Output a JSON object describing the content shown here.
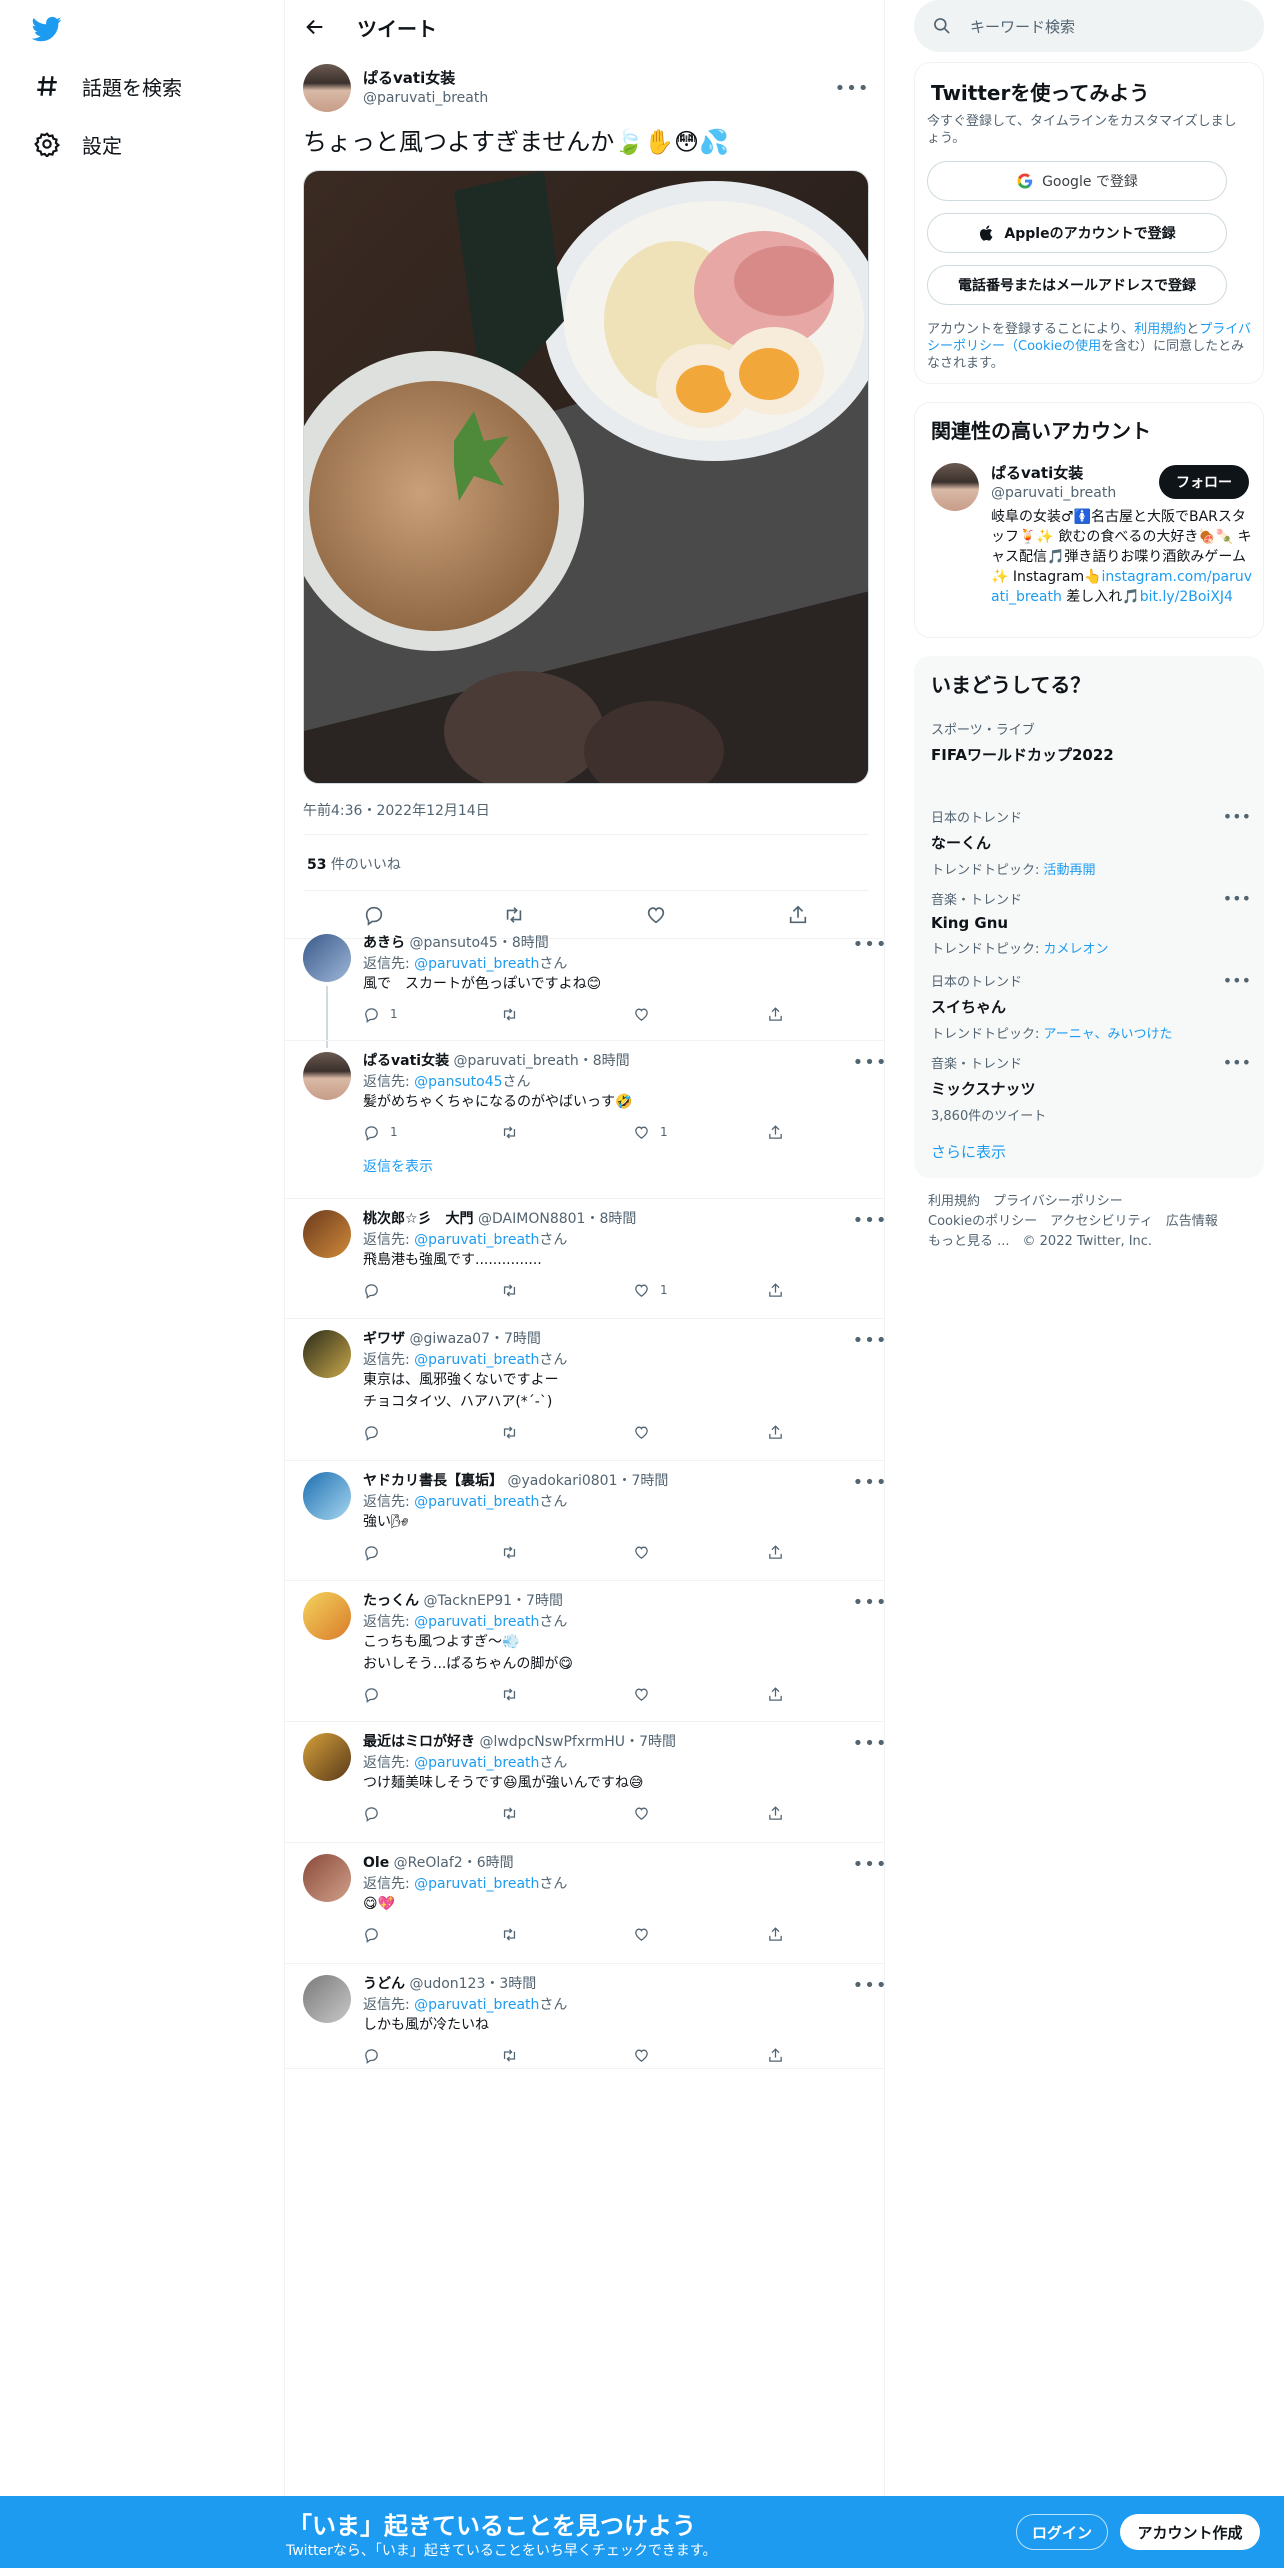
{
  "nav": {
    "items": [
      {
        "label": "話題を検索",
        "icon": "hashtag-icon"
      },
      {
        "label": "設定",
        "icon": "gear-icon"
      }
    ]
  },
  "header": {
    "title": "ツイート"
  },
  "tweet": {
    "display_name": "ぱるvati女装",
    "username": "@paruvati_breath",
    "text": "ちょっと風つよすぎませんか🍃✋😳💦",
    "timestamp": "午前4:36・2022年12月14日",
    "likes_count": "53",
    "likes_label": " 件のいいね"
  },
  "replies": [
    {
      "name": "あきら",
      "handle": "@pansuto45",
      "time": "8時間",
      "reply_to": "@paruvati_breath",
      "text": [
        "風で　スカートが色っぽいですよね😊"
      ],
      "reply_count": "1",
      "retweet_count": "",
      "like_count": ""
    },
    {
      "name": "ぱるvati女装",
      "handle": "@paruvati_breath",
      "time": "8時間",
      "reply_to": "@pansuto45",
      "text": [
        "髪がめちゃくちゃになるのがやばいっす🤣"
      ],
      "reply_count": "1",
      "retweet_count": "",
      "like_count": "1"
    },
    {
      "name": "桃次郎☆彡　大門",
      "handle": "@DAIMON8801",
      "time": "8時間",
      "reply_to": "@paruvati_breath",
      "text": [
        "飛島港も強風です..............."
      ],
      "reply_count": "",
      "retweet_count": "",
      "like_count": "1"
    },
    {
      "name": "ギワザ",
      "handle": "@giwaza07",
      "time": "7時間",
      "reply_to": "@paruvati_breath",
      "text": [
        "東京は、風邪強くないですよー",
        "チョコタイツ、ハアハア(*´-`)"
      ],
      "reply_count": "",
      "retweet_count": "",
      "like_count": ""
    },
    {
      "name": "ヤドカリ書長【裏垢】",
      "handle": "@yadokari0801",
      "time": "7時間",
      "reply_to": "@paruvati_breath",
      "text": [
        "強い🌬"
      ],
      "reply_count": "",
      "retweet_count": "",
      "like_count": ""
    },
    {
      "name": "たっくん",
      "handle": "@TacknEP91",
      "time": "7時間",
      "reply_to": "@paruvati_breath",
      "text": [
        "こっちも風つよすぎ～💨",
        "おいしそう...ぱるちゃんの脚が😋"
      ],
      "reply_count": "",
      "retweet_count": "",
      "like_count": ""
    },
    {
      "name": "最近はミロが好き",
      "handle": "@lwdpcNswPfxrmHU",
      "time": "7時間",
      "reply_to": "@paruvati_breath",
      "text": [
        "つけ麺美味しそうです😆風が強いんですね😅"
      ],
      "reply_count": "",
      "retweet_count": "",
      "like_count": ""
    },
    {
      "name": "Ole",
      "handle": "@ReOlaf2",
      "time": "6時間",
      "reply_to": "@paruvati_breath",
      "text": [
        "😋💖"
      ],
      "reply_count": "",
      "retweet_count": "",
      "like_count": ""
    },
    {
      "name": "うどん",
      "handle": "@udon123",
      "time": "3時間",
      "reply_to": "@paruvati_breath",
      "text": [
        "しかも風が冷たいね"
      ],
      "reply_count": "",
      "retweet_count": "",
      "like_count": ""
    }
  ],
  "common": {
    "reply_prefix": "返信先: ",
    "reply_suffix": "さん",
    "show_replies": "返信を表示",
    "sep": "・"
  },
  "search": {
    "placeholder": "キーワード検索"
  },
  "signup_card": {
    "title": "Twitterを使ってみよう",
    "subtitle": "今すぐ登録して、タイムラインをカスタマイズしましょう。",
    "google_btn": "Google で登録",
    "apple_btn": "Appleのアカウントで登録",
    "phone_btn": "電話番号またはメールアドレスで登録",
    "terms_1": "アカウントを登録することにより、",
    "terms_link1": "利用規約",
    "terms_2": "と",
    "terms_link2": "プライバシーポリシー（Cookieの使用",
    "terms_3": "を含む）に同意したとみなされます。"
  },
  "related": {
    "title": "関連性の高いアカウント",
    "name": "ぱるvati女装",
    "handle": "@paruvati_breath",
    "follow": "フォロー",
    "bio_1": "岐阜の女装♂🚺名古屋と大阪でBARスタッフ🍹✨ 飲むの食べるの大好き🍖🍡 キャス配信🎵弾き語りお喋り酒飲みゲーム✨ Instagram👆",
    "bio_link1": "instagram.com/paruvati_breath",
    "bio_2": " 差し入れ🎵",
    "bio_link2": "bit.ly/2BoiXJ4"
  },
  "trends": {
    "title": "いまどうしてる？",
    "items": [
      {
        "meta": "スポーツ・ライブ",
        "name": "FIFAワールドカップ2022",
        "sub_label": "",
        "sub_link": ""
      },
      {
        "meta": "日本のトレンド",
        "name": "なーくん",
        "sub_label": "トレンドトピック: ",
        "sub_link": "活動再開"
      },
      {
        "meta": "音楽・トレンド",
        "name": "King Gnu",
        "sub_label": "トレンドトピック: ",
        "sub_link": "カメレオン"
      },
      {
        "meta": "日本のトレンド",
        "name": "スイちゃん",
        "sub_label": "トレンドトピック: ",
        "sub_link": "アーニャ、みいつけた"
      },
      {
        "meta": "音楽・トレンド",
        "name": "ミックスナッツ",
        "sub_label": "3,860件のツイート",
        "sub_link": ""
      }
    ],
    "show_more": "さらに表示"
  },
  "footer": {
    "line1": "利用規約　プライバシーポリシー",
    "line2": "Cookieのポリシー　アクセシビリティ　広告情報",
    "line3": "もっと見る ...　© 2022 Twitter, Inc."
  },
  "bottom_bar": {
    "title": "「いま」起きていることを見つけよう",
    "subtitle": "Twitterなら、「いま」起きていることをいち早くチェックできます。",
    "login": "ログイン",
    "signup": "アカウント作成"
  },
  "colors": {
    "accent": "#1d9bf0",
    "text": "#0f1419",
    "secondary": "#536471",
    "border": "#eff3f4"
  }
}
